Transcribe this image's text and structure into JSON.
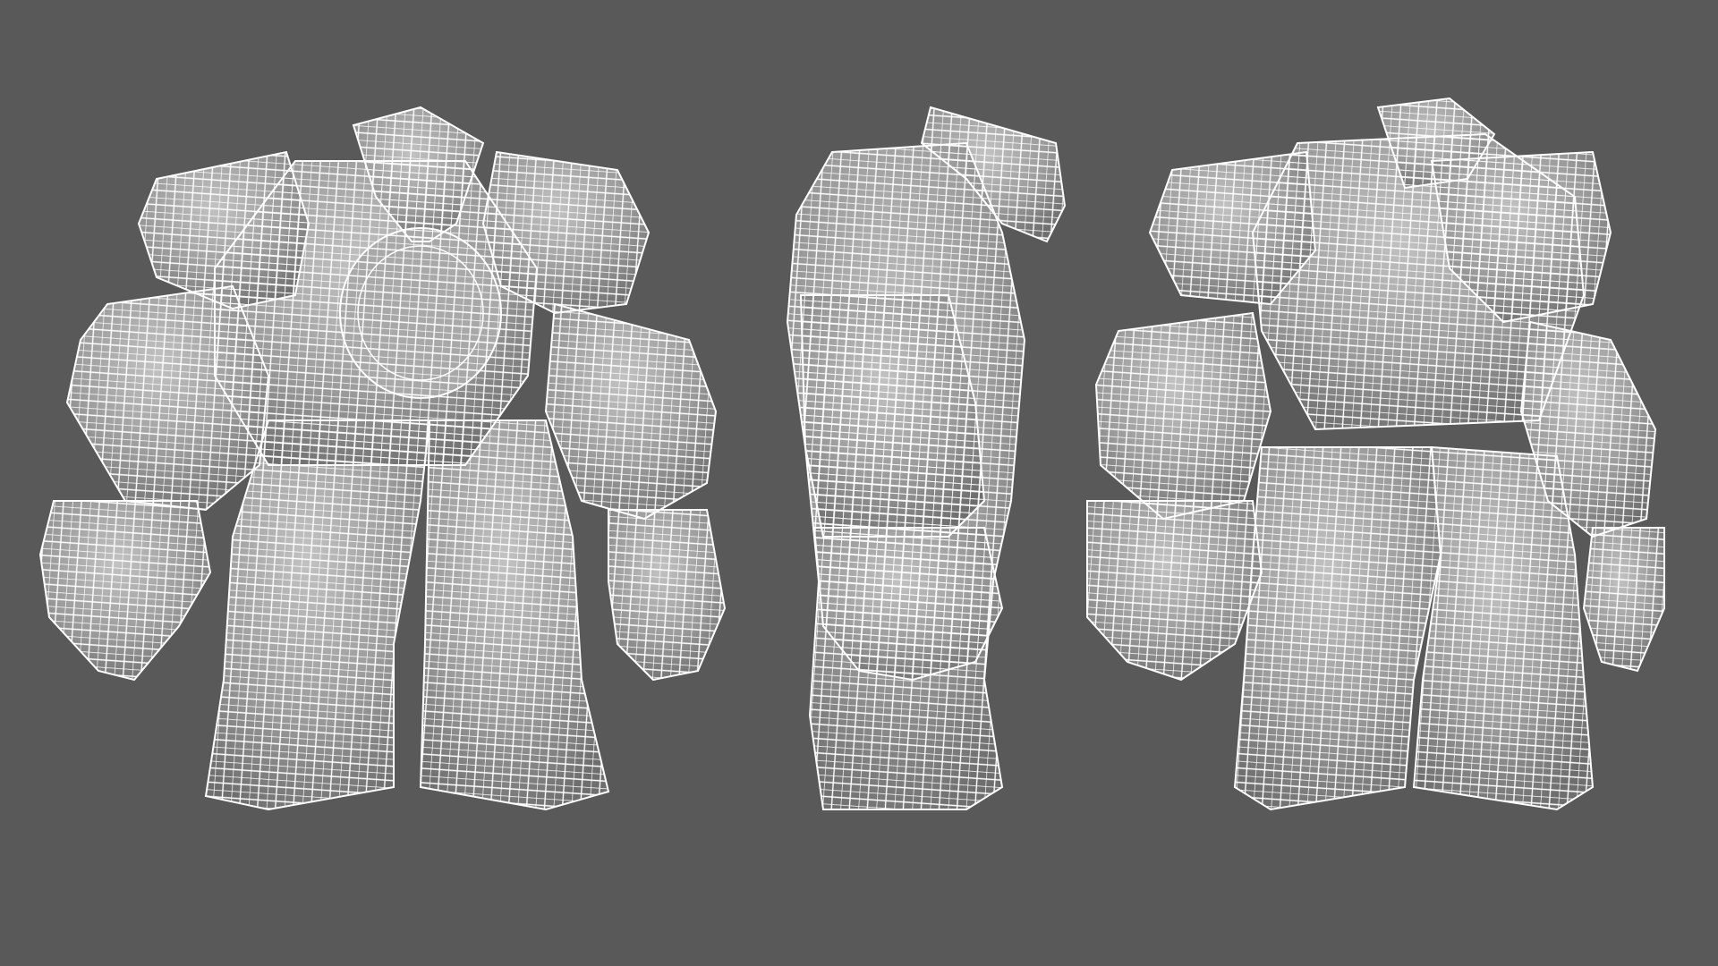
{
  "scene": {
    "background_color": "#595959",
    "mesh_fill_color": "#9a9a9a",
    "mesh_shadow_color": "#6e6e6e",
    "mesh_highlight_color": "#c2c2c2",
    "wireframe_color": "#ffffff"
  },
  "views": [
    {
      "name": "front-view",
      "subject": "golem-character",
      "facing": "front"
    },
    {
      "name": "side-view",
      "subject": "golem-character",
      "facing": "side"
    },
    {
      "name": "back-view",
      "subject": "golem-character",
      "facing": "back"
    }
  ]
}
